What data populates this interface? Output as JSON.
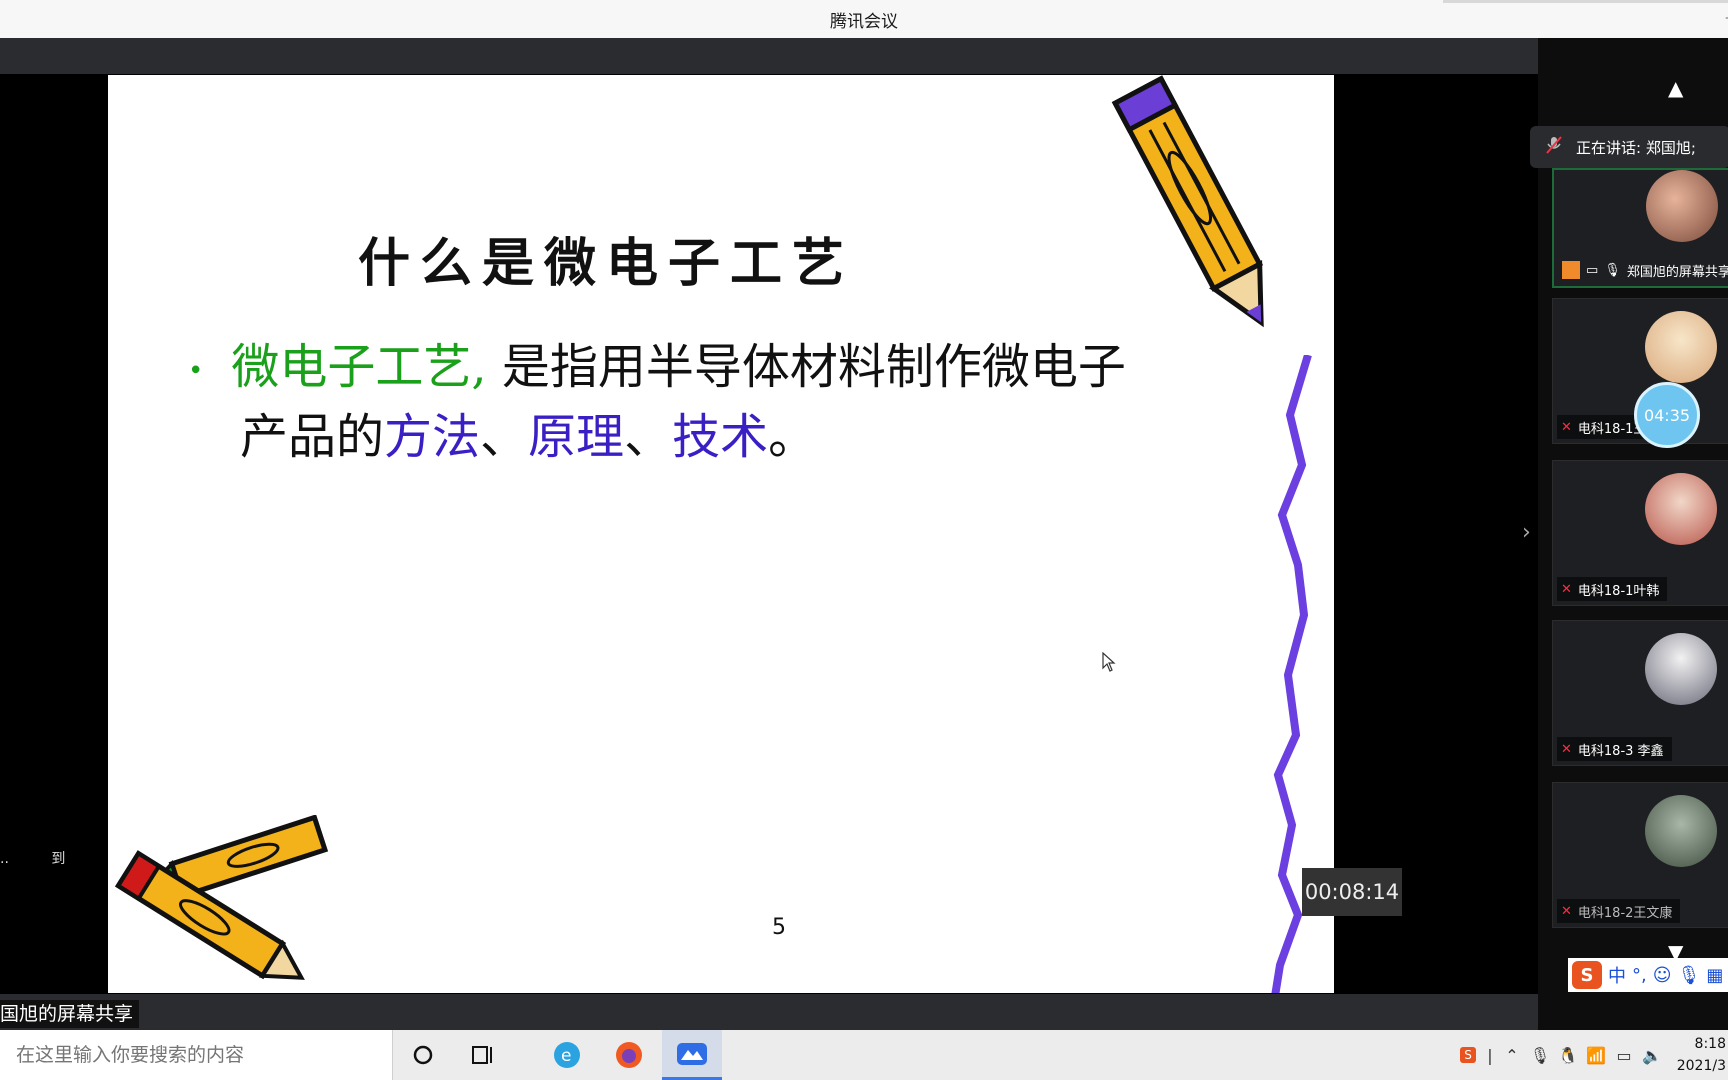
{
  "window": {
    "title": "腾讯会议"
  },
  "stage": {
    "share_label": "国旭的屏幕共享",
    "left_note": [
      "..",
      "到"
    ],
    "timer": "00:08:14"
  },
  "slide": {
    "title": "什么是微电子工艺",
    "bullet_term": "微电子工艺,",
    "bullet_text1": "是指用半导体材料制作微电子",
    "bullet_text2_prefix": "产品的",
    "bullet_word1": "方法",
    "sep1": "、",
    "bullet_word2": "原理",
    "sep2": "、",
    "bullet_word3": "技术",
    "bullet_end": "。",
    "page_number": "5",
    "colors": {
      "green": "#1aa01a",
      "purple": "#3a1fc4"
    }
  },
  "participants": {
    "speaking": "正在讲话: 郑国旭;",
    "list": [
      {
        "name": "郑国旭的屏幕共享",
        "active": true
      },
      {
        "name": "电科18-1王",
        "muted": true
      },
      {
        "name": "电科18-1叶韩",
        "muted": true
      },
      {
        "name": "电科18-3 李鑫",
        "muted": true
      },
      {
        "name": "电科18-2王文康",
        "muted": true
      }
    ],
    "call_timer": "04:35"
  },
  "ime": {
    "mode": "中",
    "punct": "°,"
  },
  "taskbar": {
    "search_placeholder": "在这里输入你要搜索的内容",
    "clock_time": "8:18",
    "clock_date": "2021/3"
  }
}
